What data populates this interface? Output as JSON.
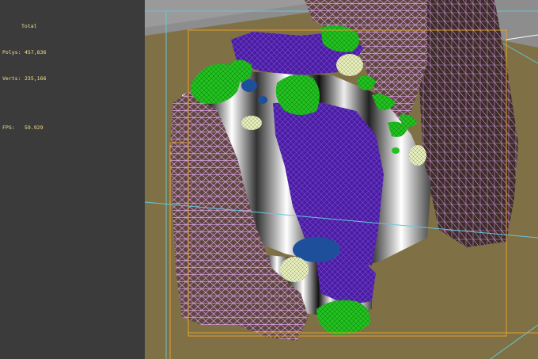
{
  "viewport": {
    "stats": {
      "header": "Total",
      "polys_label": "Polys:",
      "polys_value": "457,836",
      "verts_label": "Verts:",
      "verts_value": "235,166",
      "fps_label": "FPS:",
      "fps_value": "59.929"
    },
    "colors": {
      "left_pane": "#3b3b3b",
      "ground": "#7f7045",
      "bg_gray": "#8d8d8d",
      "wire_rock": "#d9a0e0",
      "rock_fill": "#5e4740",
      "water_purple": "#4a1ca0",
      "foliage": "#22c020",
      "bounding_box": "#e3a030",
      "grid_line": "#66c8d8",
      "stats_text": "#f2e08a"
    }
  }
}
